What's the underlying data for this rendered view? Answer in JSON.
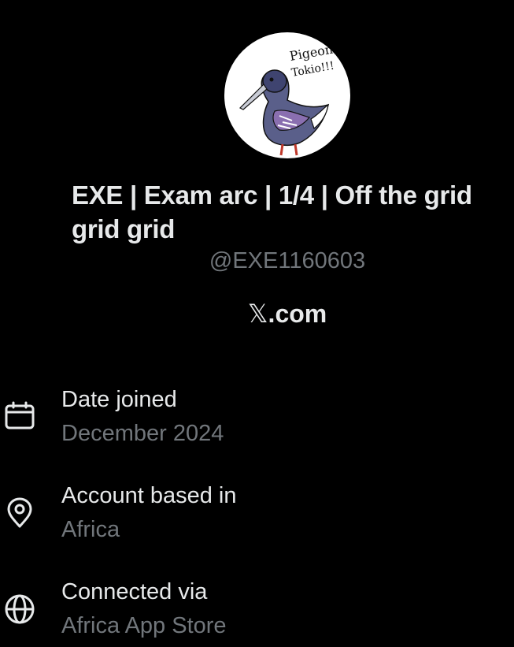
{
  "profile": {
    "avatar_text_line1": "Pigeon",
    "avatar_text_line2": "Tokio!!!",
    "display_name": "EXE | Exam arc | 1/4 | Off the grid grid grid",
    "handle": "@EXE1160603",
    "site_logo": "𝕏",
    "site_suffix": ".com"
  },
  "about": {
    "items": [
      {
        "icon": "calendar-icon",
        "label": "Date joined",
        "value": "December 2024"
      },
      {
        "icon": "location-pin-icon",
        "label": "Account based in",
        "value": "Africa"
      },
      {
        "icon": "globe-icon",
        "label": "Connected via",
        "value": "Africa App Store"
      }
    ]
  },
  "colors": {
    "background": "#000000",
    "primary_text": "#e7e9ea",
    "secondary_text": "#71767b"
  }
}
